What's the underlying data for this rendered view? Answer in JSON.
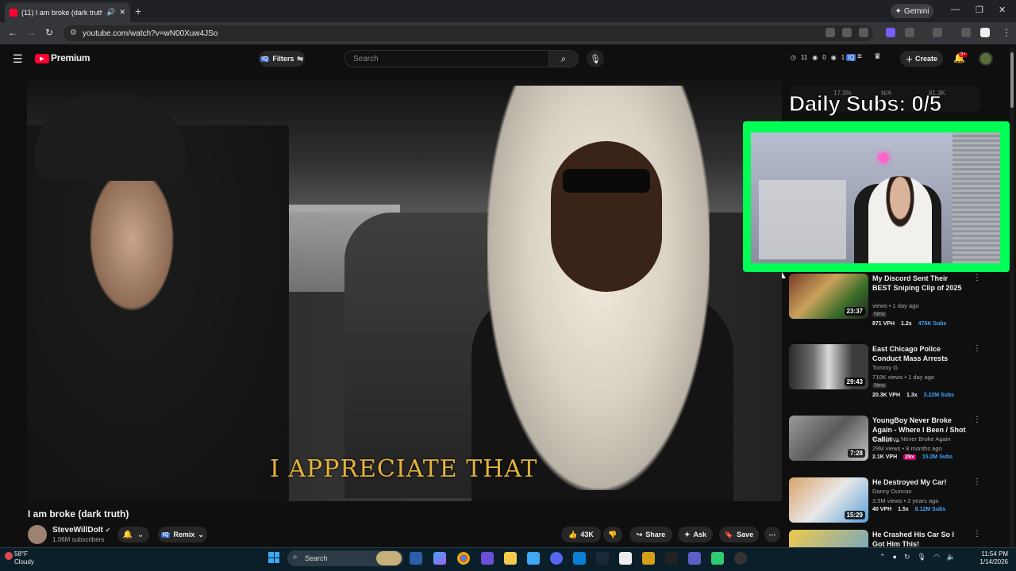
{
  "browser": {
    "tab_title": "(11) I am broke (dark truth)",
    "tab_close": "✕",
    "new_tab": "+",
    "gemini_label": "Gemini",
    "url": "youtube.com/watch?v=wN00Xuw4JSo",
    "win_min": "—",
    "win_max": "❐",
    "win_close": "✕"
  },
  "masthead": {
    "brand": "Premium",
    "filters_label": "Filters",
    "search_placeholder": "Search",
    "stat1": "11",
    "stat2": "0",
    "stat3": "1",
    "create_label": "Create",
    "notif_count": "9+"
  },
  "video": {
    "subtitle": "I APPRECIATE THAT",
    "title": "I am broke (dark truth)",
    "channel": "SteveWillDoIt",
    "subscribers": "1.06M subscribers",
    "remix_label": "Remix",
    "likes": "43K",
    "share_label": "Share",
    "ask_label": "Ask",
    "save_label": "Save"
  },
  "overlay": {
    "daily_subs": "Daily Subs: 0/5",
    "metric1": "17.3%",
    "metric2": "N/A",
    "metric3": "81.3K"
  },
  "recommendations": [
    {
      "title": "My Discord Sent Their BEST Sniping Clip of 2025",
      "channel": "",
      "meta": "views • 1 day ago",
      "new": "New",
      "vph": "871 VPH",
      "ratio": "1.2x",
      "subs": "476K Subs",
      "duration": "23:37"
    },
    {
      "title": "East Chicago Police Conduct Mass Arrests",
      "channel": "Tommy G",
      "meta": "710K views • 1 day ago",
      "new": "New",
      "vph": "20.3K VPH",
      "ratio": "1.3x",
      "subs": "3.22M Subs",
      "duration": "29:43"
    },
    {
      "title": "YoungBoy Never Broke Again - Where I Been / Shot Callin ...",
      "channel": "YoungBoy Never Broke Again",
      "meta": "29M views • 8 months ago",
      "new": "",
      "vph": "2.1K VPH",
      "ratio": "29x",
      "subs": "15.2M Subs",
      "duration": "7:28"
    },
    {
      "title": "He Destroyed My Car!",
      "channel": "Danny Duncan",
      "meta": "3.5M views • 2 years ago",
      "new": "",
      "vph": "40 VPH",
      "ratio": "1.5x",
      "subs": "8.12M Subs",
      "duration": "15:29"
    },
    {
      "title": "He Crashed His Car So I Got Him This!",
      "channel": "",
      "meta": "",
      "new": "",
      "vph": "",
      "ratio": "",
      "subs": "",
      "duration": ""
    }
  ],
  "taskbar": {
    "temp": "58°F",
    "condition": "Cloudy",
    "search_label": "Search",
    "time": "11:54 PM",
    "date": "1/14/2026"
  },
  "colors": {
    "youtube_red": "#ff0033",
    "overlay_green": "#00ff55",
    "subs_blue": "#3ea6ff"
  }
}
